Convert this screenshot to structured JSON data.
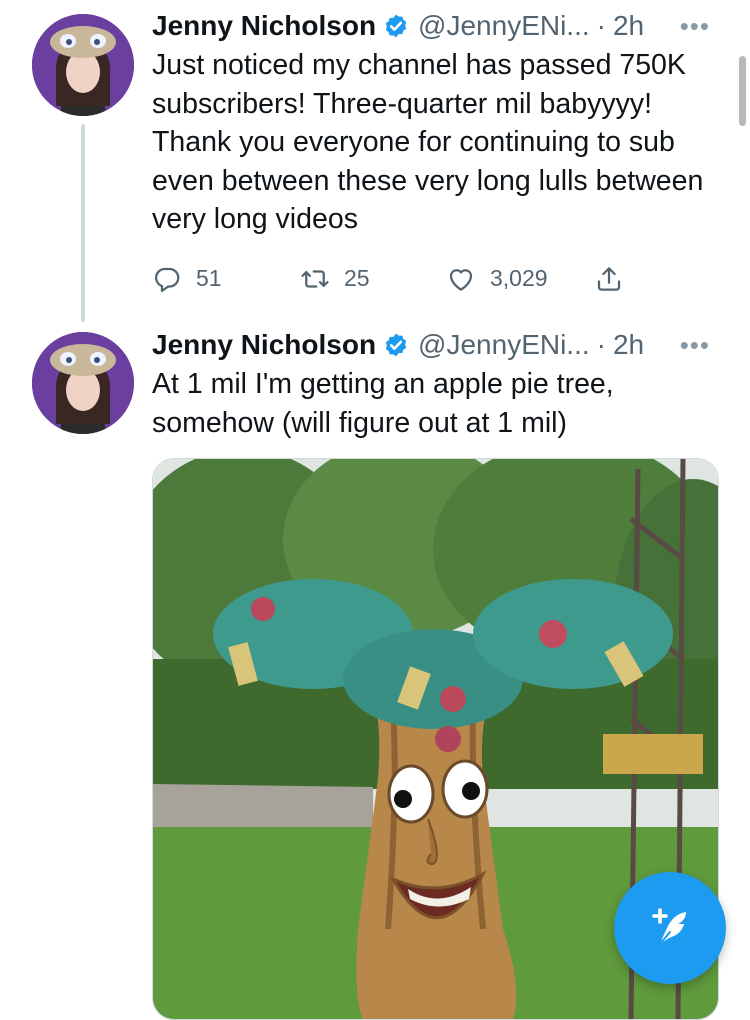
{
  "tweets": [
    {
      "author_name": "Jenny Nicholson",
      "handle": "@JennyENi...",
      "separator": "·",
      "time": "2h",
      "more": "•••",
      "text": "Just noticed my channel has passed 750K subscribers! Three-quarter mil babyyyy! Thank you everyone for continuing to sub even between these very long lulls between very long videos",
      "reply_count": "51",
      "retweet_count": "25",
      "like_count": "3,029"
    },
    {
      "author_name": "Jenny Nicholson",
      "handle": "@JennyENi...",
      "separator": "·",
      "time": "2h",
      "more": "•••",
      "text": "At 1 mil I'm getting an apple pie tree, somehow (will figure out at 1 mil)"
    }
  ],
  "colors": {
    "accent": "#1d9bf0",
    "secondary_text": "#536471",
    "avatar_bg": "#6b3fa0"
  },
  "icons": {
    "reply": "reply-icon",
    "retweet": "retweet-icon",
    "like": "heart-icon",
    "share": "share-icon",
    "verified": "verified-badge-icon",
    "compose": "compose-tweet-icon"
  }
}
